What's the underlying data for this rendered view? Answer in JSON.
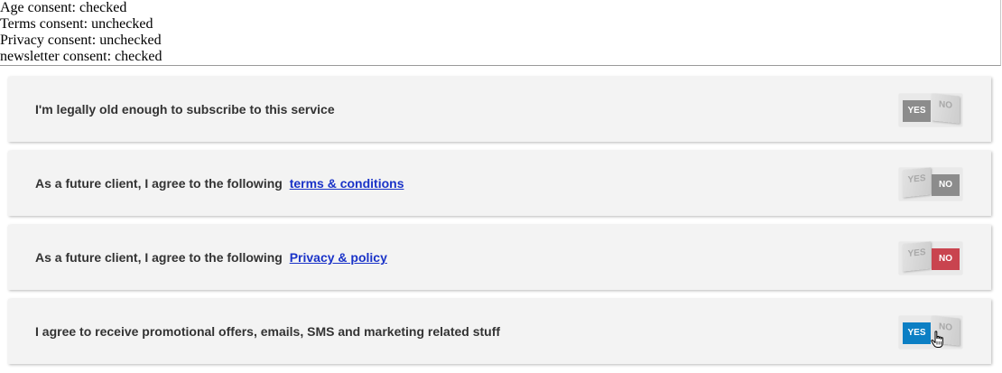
{
  "status": {
    "lines": [
      "Age consent: checked",
      "Terms consent: unchecked",
      "Privacy consent: unchecked",
      "newsletter consent: checked"
    ]
  },
  "consents": [
    {
      "label": "I'm legally old enough to subscribe to this service",
      "link": "",
      "yes": "YES",
      "no": "NO",
      "state": "yes",
      "active_color": "#8c8c8c"
    },
    {
      "label": "As a future client, I agree to the following",
      "link": "terms & conditions",
      "yes": "YES",
      "no": "NO",
      "state": "no",
      "active_color": "#8c8c8c"
    },
    {
      "label": "As a future client, I agree to the following",
      "link": "Privacy & policy",
      "yes": "YES",
      "no": "NO",
      "state": "no",
      "active_color": "#c9444f"
    },
    {
      "label": "I agree to receive promotional offers, emails, SMS and marketing related stuff",
      "link": "",
      "yes": "YES",
      "no": "NO",
      "state": "yes",
      "active_color": "#0c7fc4"
    }
  ],
  "cursor": {
    "icon": "hand-pointer-icon"
  }
}
